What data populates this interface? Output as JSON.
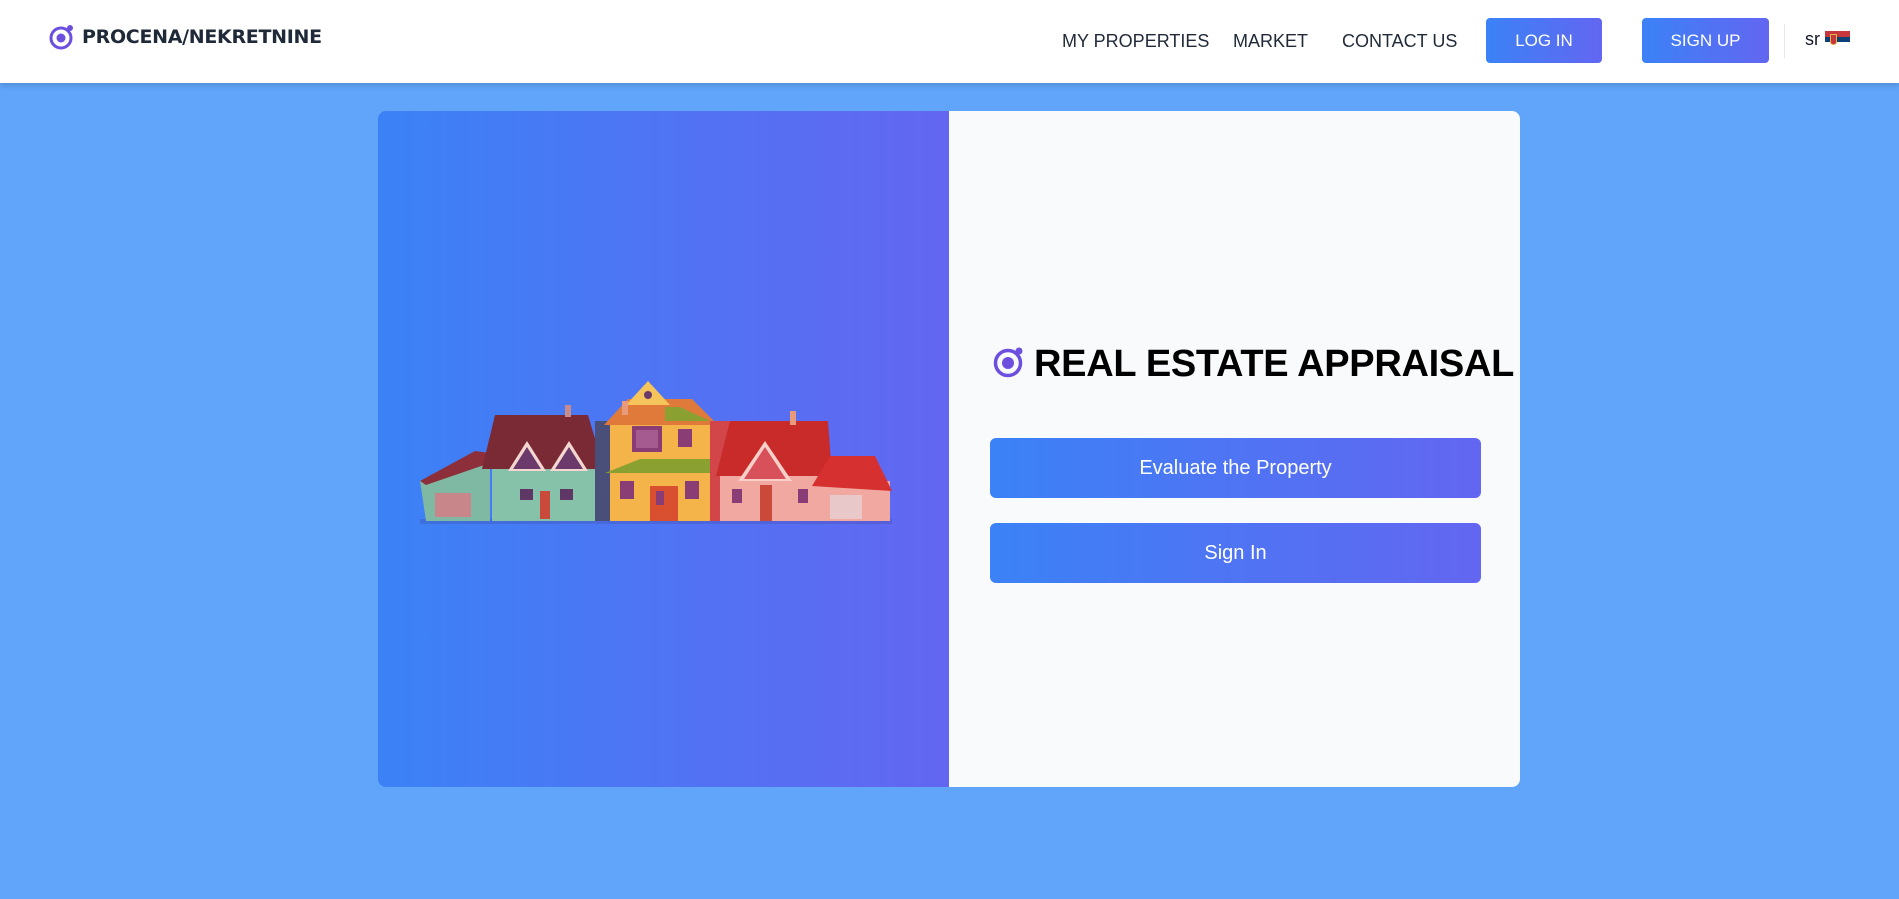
{
  "header": {
    "logo_text": "PROCENA/NEKRETNINE",
    "nav": {
      "my_properties": "MY PROPERTIES",
      "market": "MARKET",
      "contact_us": "CONTACT US"
    },
    "login_label": "LOG IN",
    "signup_label": "SIGN UP",
    "language": {
      "code": "sr",
      "flag_icon": "serbia-flag-icon"
    }
  },
  "hero": {
    "illustration": "houses-illustration",
    "title": "REAL ESTATE APPRAISAL",
    "evaluate_label": "Evaluate the Property",
    "signin_label": "Sign In"
  },
  "colors": {
    "page_background": "#60a5fa",
    "gradient_start": "#3b82f6",
    "gradient_end": "#6366f1",
    "logo_accent": "#6d4fe0",
    "card_right_background": "#f8fafc"
  }
}
